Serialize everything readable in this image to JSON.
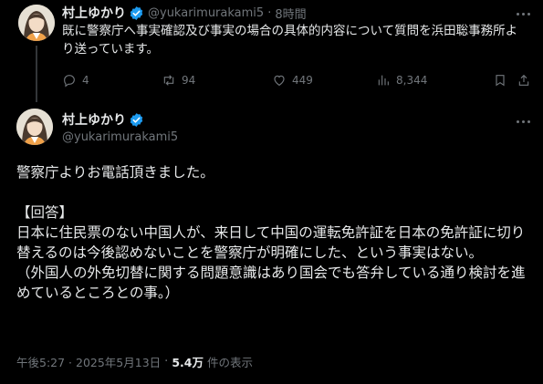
{
  "post1": {
    "author_name": "村上ゆかり",
    "handle": "@yukarimurakami5",
    "time": "8時間",
    "text": "既に警察庁へ事実確認及び事実の場合の具体的内容について質問を浜田聡事務所より送っています。",
    "stats": {
      "replies": "4",
      "reposts": "94",
      "likes": "449",
      "views": "8,344"
    }
  },
  "post2": {
    "author_name": "村上ゆかり",
    "handle": "@yukarimurakami5",
    "paragraphs": [
      "警察庁よりお電話頂きました。",
      "",
      "【回答】",
      "日本に住民票のない中国人が、来日して中国の運転免許証を日本の免許証に切り替えるのは今後認めないことを警察庁が明確にした、という事実はない。",
      "（外国人の外免切替に関する問題意識はあり国会でも答弁している通り検討を進めているところとの事。）"
    ],
    "timestamp": "午後5:27 · 2025年5月13日",
    "view_count": "5.4万",
    "view_label": "件の表示"
  },
  "icons": {
    "verified": "verified-badge-icon",
    "reply": "reply-icon",
    "repost": "repost-icon",
    "like": "heart-icon",
    "views": "views-chart-icon",
    "bookmark": "bookmark-icon",
    "share": "share-icon",
    "more": "more-dots-icon"
  },
  "colors": {
    "background": "#000000",
    "text": "#e7e9ea",
    "secondary": "#71767b",
    "verified": "#1d9bf0",
    "divider": "#333639"
  }
}
